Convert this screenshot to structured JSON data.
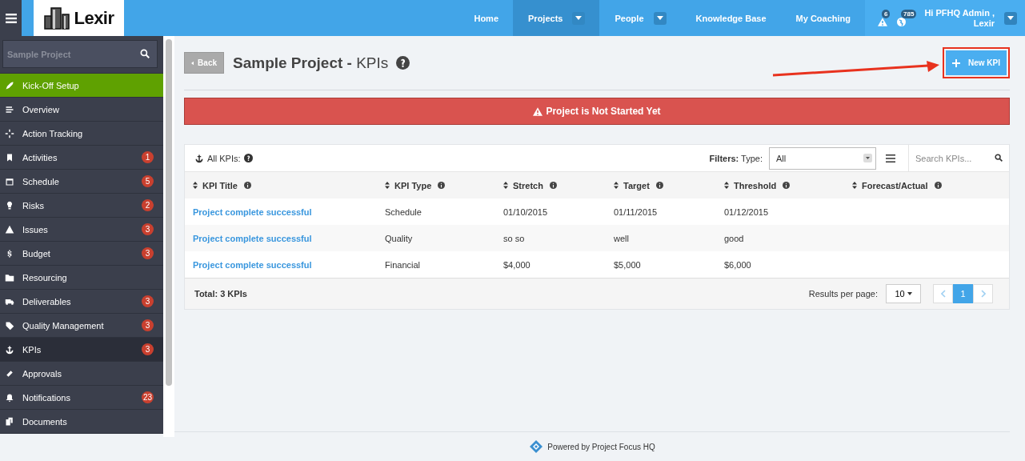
{
  "logo": {
    "text": "Lexir"
  },
  "topbar": {
    "nav": [
      {
        "label": "Home",
        "selected": false,
        "dropdown": false
      },
      {
        "label": "Projects",
        "selected": true,
        "dropdown": true
      },
      {
        "label": "People",
        "selected": false,
        "dropdown": true
      },
      {
        "label": "Knowledge Base",
        "selected": false,
        "dropdown": false
      },
      {
        "label": "My Coaching",
        "selected": false,
        "dropdown": false
      }
    ],
    "alerts": [
      {
        "kind": "warning",
        "count": "6"
      },
      {
        "kind": "globe",
        "count": "785"
      }
    ],
    "user": {
      "greeting": "Hi PFHQ Admin ,",
      "org": "Lexir"
    }
  },
  "sidebar": {
    "search": {
      "placeholder": "Sample Project"
    },
    "items": [
      {
        "label": "Kick-Off Setup",
        "kind": "action",
        "selected": false
      },
      {
        "label": "Overview",
        "kind": "link",
        "selected": false
      },
      {
        "label": "Action Tracking",
        "kind": "link",
        "selected": false
      },
      {
        "label": "Activities",
        "kind": "link",
        "selected": false,
        "badge": "1"
      },
      {
        "label": "Schedule",
        "kind": "link",
        "selected": false,
        "badge": "5"
      },
      {
        "label": "Risks",
        "kind": "link",
        "selected": false,
        "badge": "2"
      },
      {
        "label": "Issues",
        "kind": "link",
        "selected": false,
        "badge": "3"
      },
      {
        "label": "Budget",
        "kind": "link",
        "selected": false,
        "badge": "3"
      },
      {
        "label": "Resourcing",
        "kind": "link",
        "selected": false
      },
      {
        "label": "Deliverables",
        "kind": "link",
        "selected": false,
        "badge": "3"
      },
      {
        "label": "Quality Management",
        "kind": "link",
        "selected": false,
        "badge": "3"
      },
      {
        "label": "KPIs",
        "kind": "link",
        "selected": true,
        "badge": "3"
      },
      {
        "label": "Approvals",
        "kind": "link",
        "selected": false
      },
      {
        "label": "Notifications",
        "kind": "link",
        "selected": false,
        "badge": "23"
      },
      {
        "label": "Documents",
        "kind": "link",
        "selected": false
      }
    ]
  },
  "page": {
    "back": "Back",
    "title": "**Sample Project -** KPIs",
    "new_button": "New KPI"
  },
  "alert": {
    "text": "Project is Not Started Yet"
  },
  "kpis": {
    "heading": "All KPIs:",
    "filter_label": "**Filters:** Type:",
    "type_select": "All",
    "search": {
      "placeholder": "Search KPIs..."
    },
    "columns": [
      "KPI Title",
      "KPI Type",
      "Stretch",
      "Target",
      "Threshold",
      "Forecast/Actual"
    ],
    "rows": [
      [
        "Project complete successful",
        "Schedule",
        "01/10/2015",
        "01/11/2015",
        "01/12/2015"
      ],
      [
        "Project complete successful",
        "Quality",
        "so so",
        "well",
        "good"
      ],
      [
        "Project complete successful",
        "Financial",
        "$4,000",
        "$5,000",
        "$6,000"
      ]
    ],
    "total": "Total: 3 KPIs",
    "per_page_label": "Results per page:",
    "per_page": "10",
    "pages": [
      {
        "label": "1",
        "selected": true
      }
    ]
  },
  "footer": {
    "text": "Powered by Project Focus HQ"
  }
}
